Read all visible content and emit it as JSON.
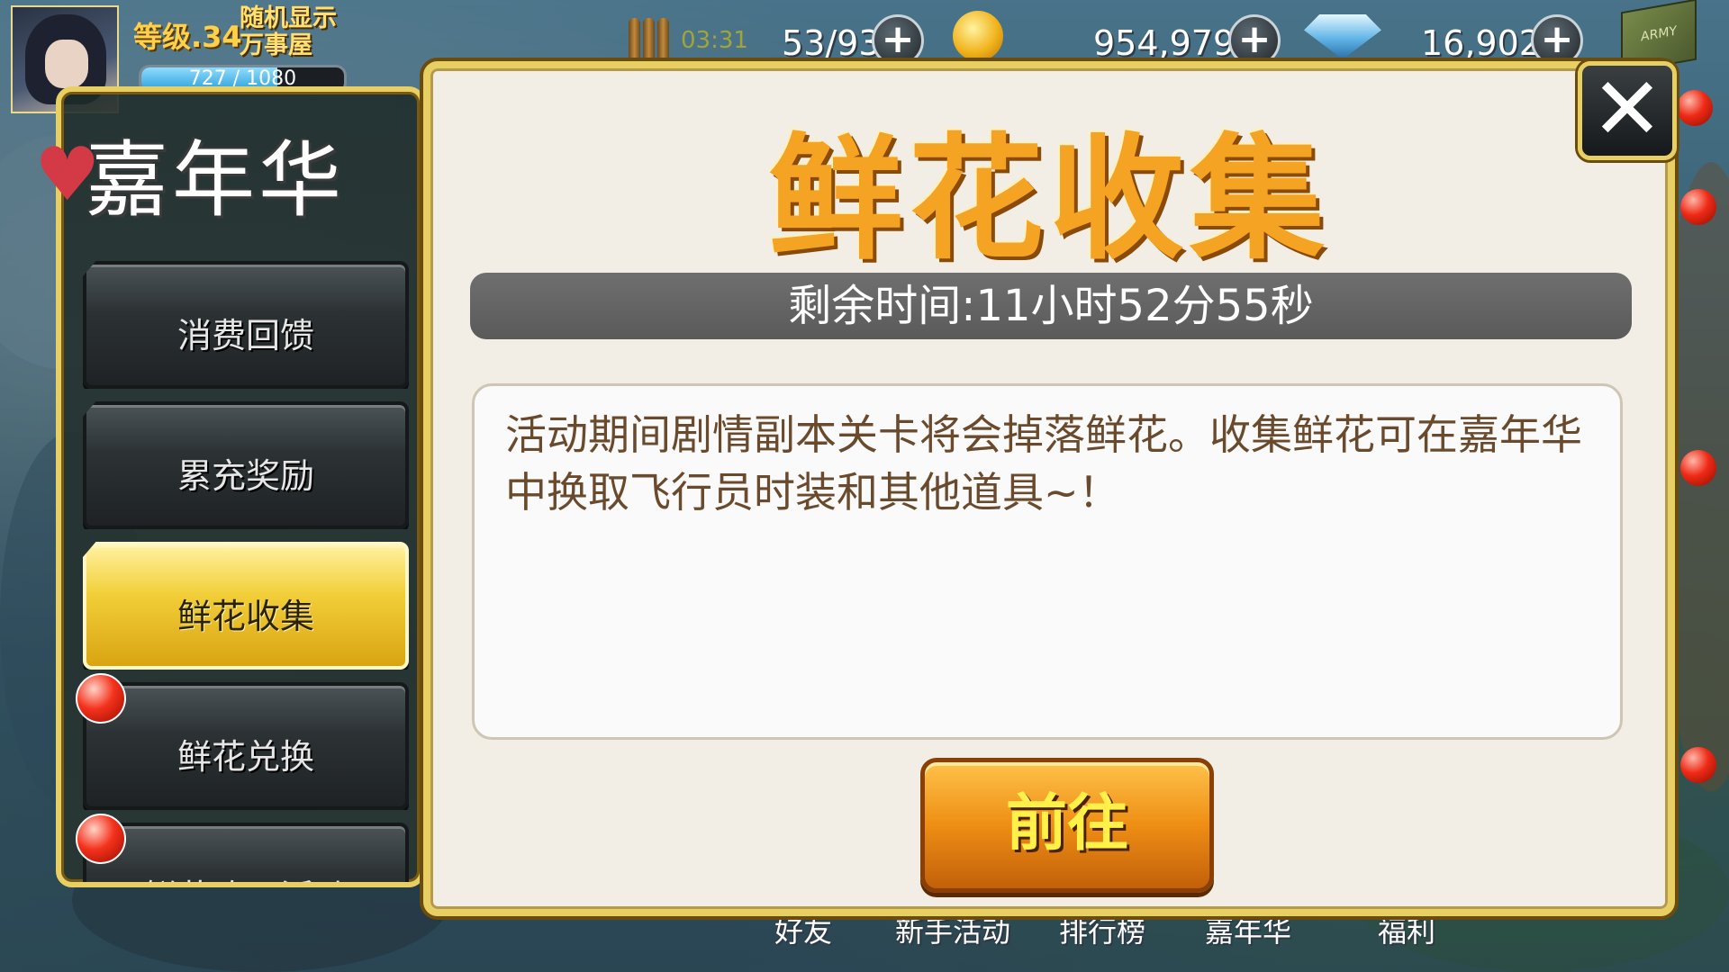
{
  "hud": {
    "level_label": "等级.34",
    "player_name": "随机显示万事屋",
    "exp_text": "727 / 1080",
    "exp_fraction": 0.673,
    "ammo_timer": "03:31",
    "ammo_value": "53/93",
    "gold_value": "954,979",
    "diamond_value": "16,902",
    "box_label": "ARMY"
  },
  "side_panel": {
    "title": "嘉年华",
    "items": [
      {
        "label": "消费回馈",
        "active": false,
        "badge": false
      },
      {
        "label": "累充奖励",
        "active": false,
        "badge": false
      },
      {
        "label": "鲜花收集",
        "active": true,
        "badge": false
      },
      {
        "label": "鲜花兑换",
        "active": false,
        "badge": true
      },
      {
        "label": "鲜花购买活动",
        "active": false,
        "badge": true
      }
    ]
  },
  "modal": {
    "title": "鲜花收集",
    "timer_text": "剩余时间:11小时52分55秒",
    "description": "活动期间剧情副本关卡将会掉落鲜花。收集鲜花可在嘉年华中换取飞行员时装和其他道具~！",
    "go_button": "前往",
    "close_icon": "✕"
  },
  "bottom_nav": {
    "items": [
      "好友",
      "新手活动",
      "排行榜",
      "嘉年华",
      "福利"
    ]
  },
  "colors": {
    "panel_border": "#e8cf63",
    "active_item": "#f2cf3a",
    "title_orange": "#f5a323",
    "badge_red": "#f4321c"
  }
}
